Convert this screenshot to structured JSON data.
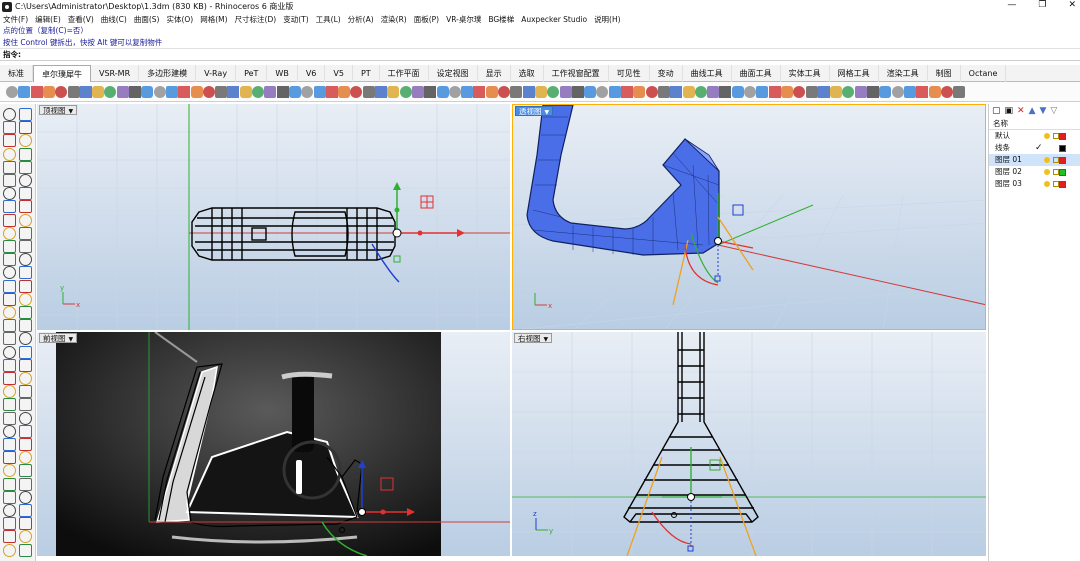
{
  "window": {
    "title": "C:\\Users\\Administrator\\Desktop\\1.3dm (830 KB) - Rhinoceros 6 商业版",
    "controls": [
      "—",
      "❐",
      "✕"
    ]
  },
  "menu": [
    "文件(F)",
    "编辑(E)",
    "查看(V)",
    "曲线(C)",
    "曲面(S)",
    "实体(O)",
    "网格(M)",
    "尺寸标注(D)",
    "变动(T)",
    "工具(L)",
    "分析(A)",
    "渲染(R)",
    "面板(P)",
    "VR-桌尔璞",
    "BG楼梯",
    "Auxpecker Studio",
    "说明(H)"
  ],
  "command_history": [
    "点的位置（复制(C)=否）",
    "按住 Control 键拆出，快按 Alt 键可以复制物件"
  ],
  "command_prompt": "指令:",
  "tabs": [
    "标准",
    "卓尔璞犀牛",
    "VSR-MR",
    "多边形建模",
    "V-Ray",
    "PeT",
    "WB",
    "V6",
    "V5",
    "PT",
    "工作平面",
    "设定视图",
    "显示",
    "选取",
    "工作视窗配置",
    "可见性",
    "变动",
    "曲线工具",
    "曲面工具",
    "实体工具",
    "网格工具",
    "渲染工具",
    "制图",
    "Octane"
  ],
  "active_tab_index": 1,
  "viewports": {
    "top": {
      "label": "顶视图"
    },
    "perspective": {
      "label": "透视图"
    },
    "front": {
      "label": "前视图"
    },
    "right": {
      "label": "右视图"
    }
  },
  "axis_labels": {
    "x": "x",
    "y": "y",
    "z": "z"
  },
  "layers": {
    "header": "名称",
    "rows": [
      {
        "name": "默认",
        "color": "#e02020",
        "selected": false,
        "current": false
      },
      {
        "name": "线条",
        "color": "#000000",
        "selected": false,
        "current": true
      },
      {
        "name": "图层 01",
        "color": "#e02020",
        "selected": true,
        "current": false
      },
      {
        "name": "图层 02",
        "color": "#20c020",
        "selected": false,
        "current": false
      },
      {
        "name": "图层 03",
        "color": "#e02020",
        "selected": false,
        "current": false
      }
    ],
    "toolbar_icons": [
      "new-layer-icon",
      "new-sublayer-icon",
      "delete-icon",
      "move-up-icon",
      "move-down-icon",
      "filter-icon"
    ]
  },
  "accent_colors": {
    "active_viewport": "#4a8de0",
    "wire_selected": "#4060d0",
    "gizmo_red": "#e53030",
    "gizmo_green": "#30b030"
  }
}
